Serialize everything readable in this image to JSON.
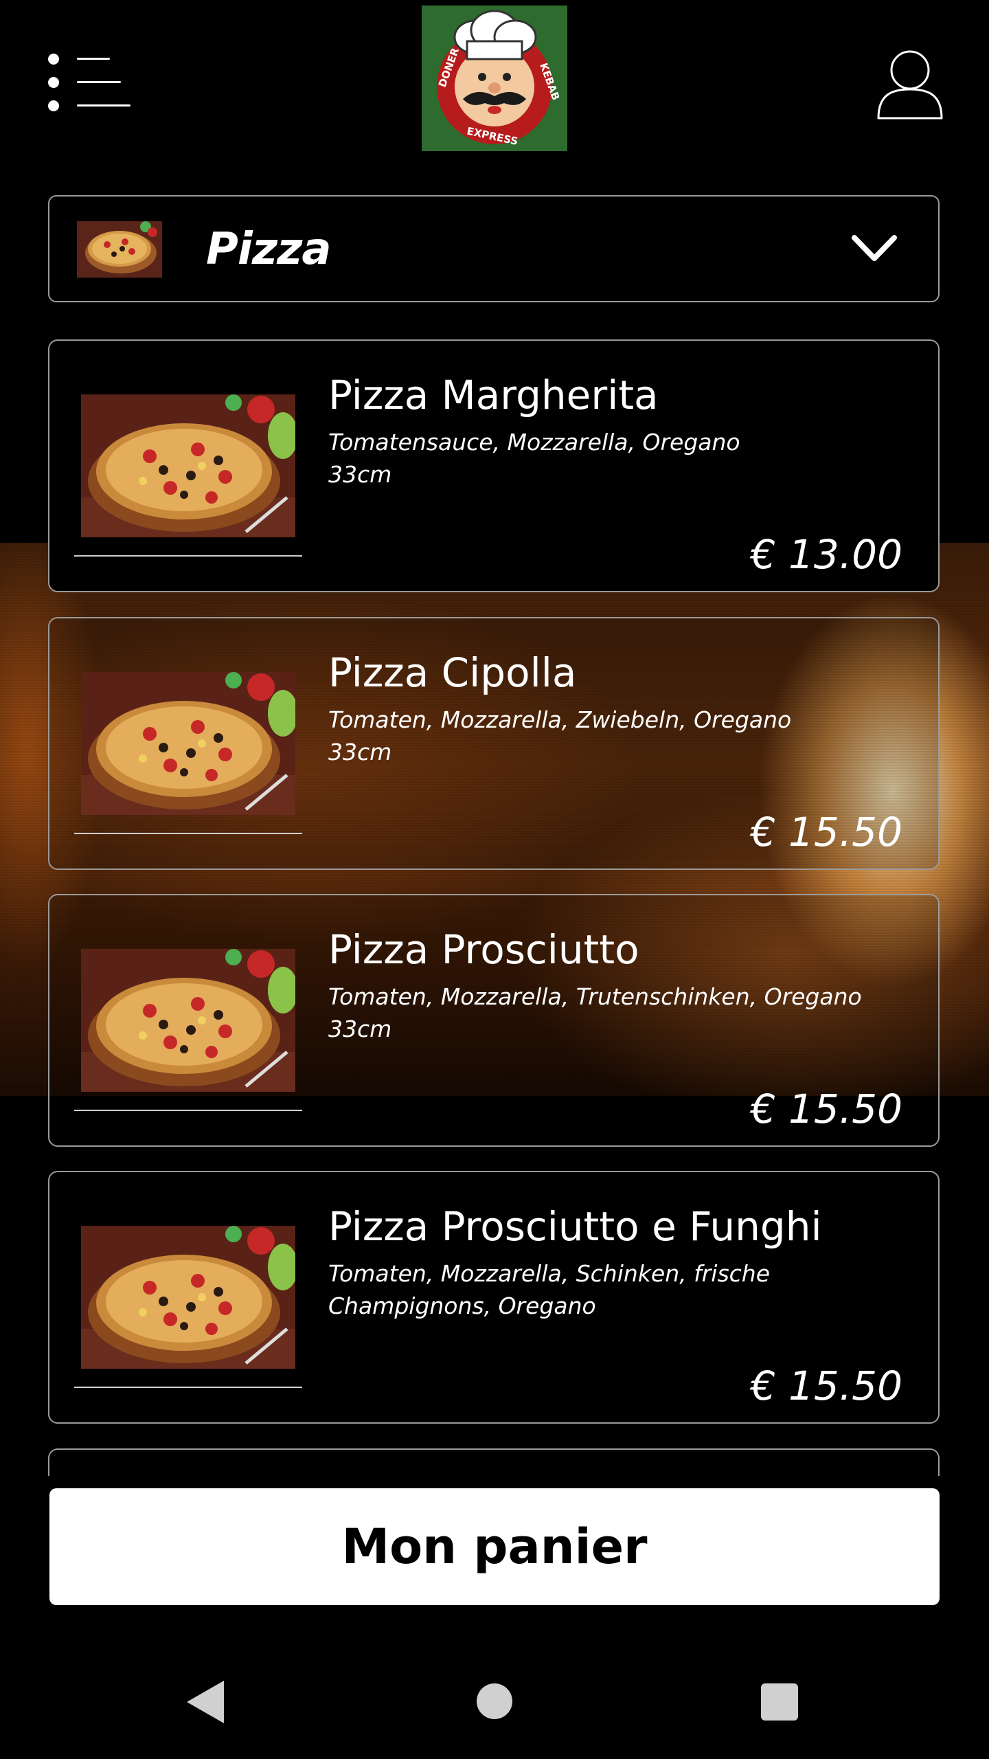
{
  "header": {
    "menu_icon": "menu-icon",
    "logo": {
      "icon": "chef-logo",
      "text_left": "DONER",
      "text_right": "KEBAB",
      "text_bottom": "EXPRESS",
      "background": "#2e6b2e"
    },
    "user_icon": "user-icon"
  },
  "category": {
    "label": "Pizza",
    "icon": "chevron-down-icon"
  },
  "products": [
    {
      "name": "Pizza Margherita",
      "description": "Tomatensauce, Mozzarella, Oregano",
      "size": "33cm",
      "price": "€ 13.00"
    },
    {
      "name": "Pizza Cipolla",
      "description": "Tomaten, Mozzarella, Zwiebeln, Oregano",
      "size": "33cm",
      "price": "€ 15.50"
    },
    {
      "name": "Pizza Prosciutto",
      "description": "Tomaten, Mozzarella, Trutenschinken, Oregano",
      "size": "33cm",
      "price": "€ 15.50"
    },
    {
      "name": "Pizza Prosciutto e Funghi",
      "description": "Tomaten, Mozzarella, Schinken, frische Champignons, Oregano",
      "size": "",
      "price": "€ 15.50"
    }
  ],
  "cart": {
    "label": "Mon panier"
  },
  "navbar": {
    "back_icon": "back-icon",
    "home_icon": "home-icon",
    "recent_icon": "recent-apps-icon"
  },
  "colors": {
    "background": "#000000",
    "text": "#ffffff",
    "card_border": "#9a9a9a",
    "cart_button": "#ffffff",
    "logo_green": "#2e6b2e"
  }
}
